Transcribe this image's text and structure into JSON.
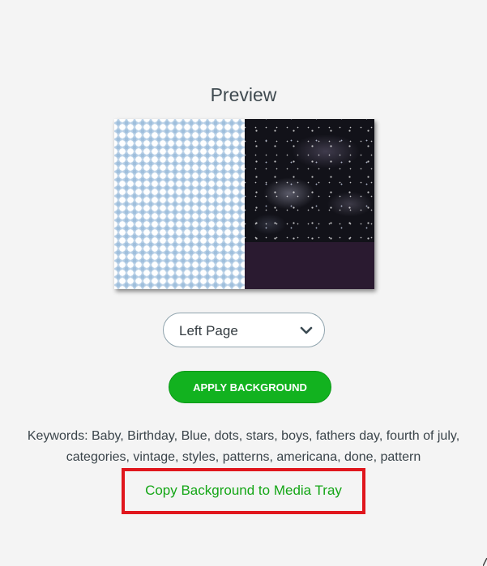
{
  "panel": {
    "title": "Preview"
  },
  "page_select": {
    "selected": "Left Page"
  },
  "apply_button": {
    "label": "APPLY BACKGROUND"
  },
  "keywords": {
    "text": "Keywords: Baby, Birthday, Blue, dots, stars, boys, fathers day, fourth of july, categories, vintage, styles, patterns, americana, done, pattern"
  },
  "copy_link": {
    "label": "Copy Background to Media Tray"
  },
  "icons": {
    "select_arrow": "chevron-down-icon"
  },
  "colors": {
    "accent_green": "#12b21f",
    "link_green": "#14a616",
    "highlight_red": "#e0161d",
    "background": "#f4f4f4"
  }
}
